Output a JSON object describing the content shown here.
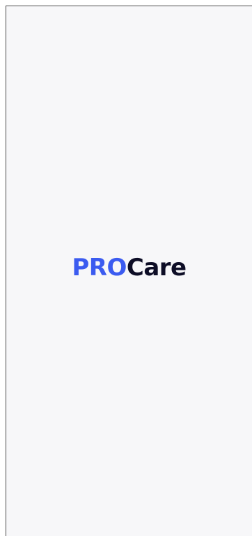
{
  "splash": {
    "logo": {
      "part_primary": "PRO",
      "part_secondary": "Care"
    }
  },
  "colors": {
    "background": "#f7f7f9",
    "brand_primary": "#3b5bf0",
    "brand_secondary": "#0d0d26",
    "frame_border": "#4a4a4a"
  }
}
